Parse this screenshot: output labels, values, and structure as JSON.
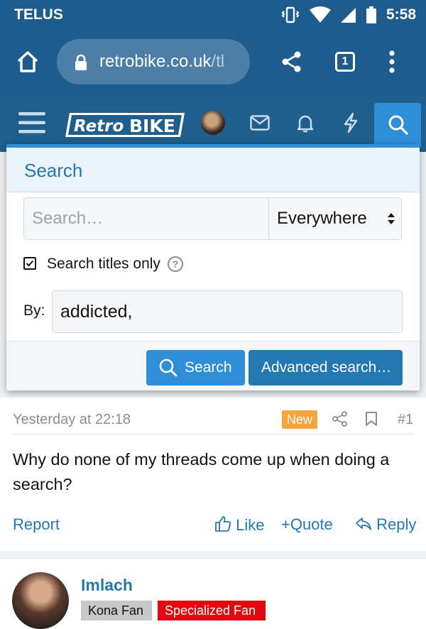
{
  "status_bar": {
    "carrier": "TELUS",
    "time": "5:58",
    "icons": [
      "vibrate-icon",
      "wifi-icon",
      "signal-icon",
      "battery-icon"
    ]
  },
  "browser": {
    "url_main": "retrobike.co.uk",
    "url_rest": "/tl",
    "tab_count": "1",
    "icons": [
      "home-icon",
      "lock-icon",
      "share-icon",
      "tabs-icon",
      "overflow-menu-icon"
    ]
  },
  "site_nav": {
    "logo_text": "RetroBIKE",
    "icons": [
      "menu-icon",
      "avatar",
      "mail-icon",
      "bell-icon",
      "lightning-icon",
      "search-icon"
    ]
  },
  "search_popup": {
    "title": "Search",
    "query_placeholder": "Search…",
    "query_value": "",
    "scope": "Everywhere",
    "titles_only_label": "Search titles only",
    "titles_only_checked": true,
    "by_label": "By:",
    "by_value": "addicted,",
    "search_button": "Search",
    "advanced_button": "Advanced search…"
  },
  "post": {
    "date": "Yesterday at 22:18",
    "badge": "New",
    "number": "#1",
    "body": "Why do none of my threads come up when doing a search?",
    "report": "Report",
    "like": "Like",
    "quote": "Quote",
    "reply": "Reply"
  },
  "next_post": {
    "username": "Imlach",
    "badges": [
      "Kona Fan",
      "Specialized Fan"
    ]
  },
  "colors": {
    "header_blue": "#1d5c8c",
    "accent_blue": "#2e8fd8",
    "link_blue": "#2577b1",
    "new_badge": "#f8a33c",
    "specialized_badge": "#e2080f"
  }
}
